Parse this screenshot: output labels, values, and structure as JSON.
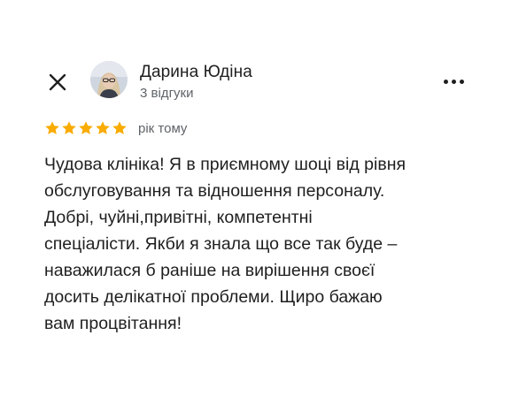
{
  "author": {
    "name": "Дарина Юдіна",
    "reviews_count": "3 відгуки"
  },
  "rating": {
    "stars": 5,
    "max": 5,
    "time_ago": "рік тому",
    "star_color": "#f9ab00"
  },
  "review": {
    "text": "Чудова клініка! Я в приємному шоці від рівня\nобслуговування та відношення персоналу.\nДобрі, чуйні,привітні, компетентні\nспеціалісти. Якби я знала що все так буде –\nнаважилася б раніше на вирішення своєї\nдосить делікатної проблеми. Щиро бажаю\nвам процвітання!"
  },
  "icons": {
    "close": "close-icon",
    "more": "more-options-icon"
  }
}
